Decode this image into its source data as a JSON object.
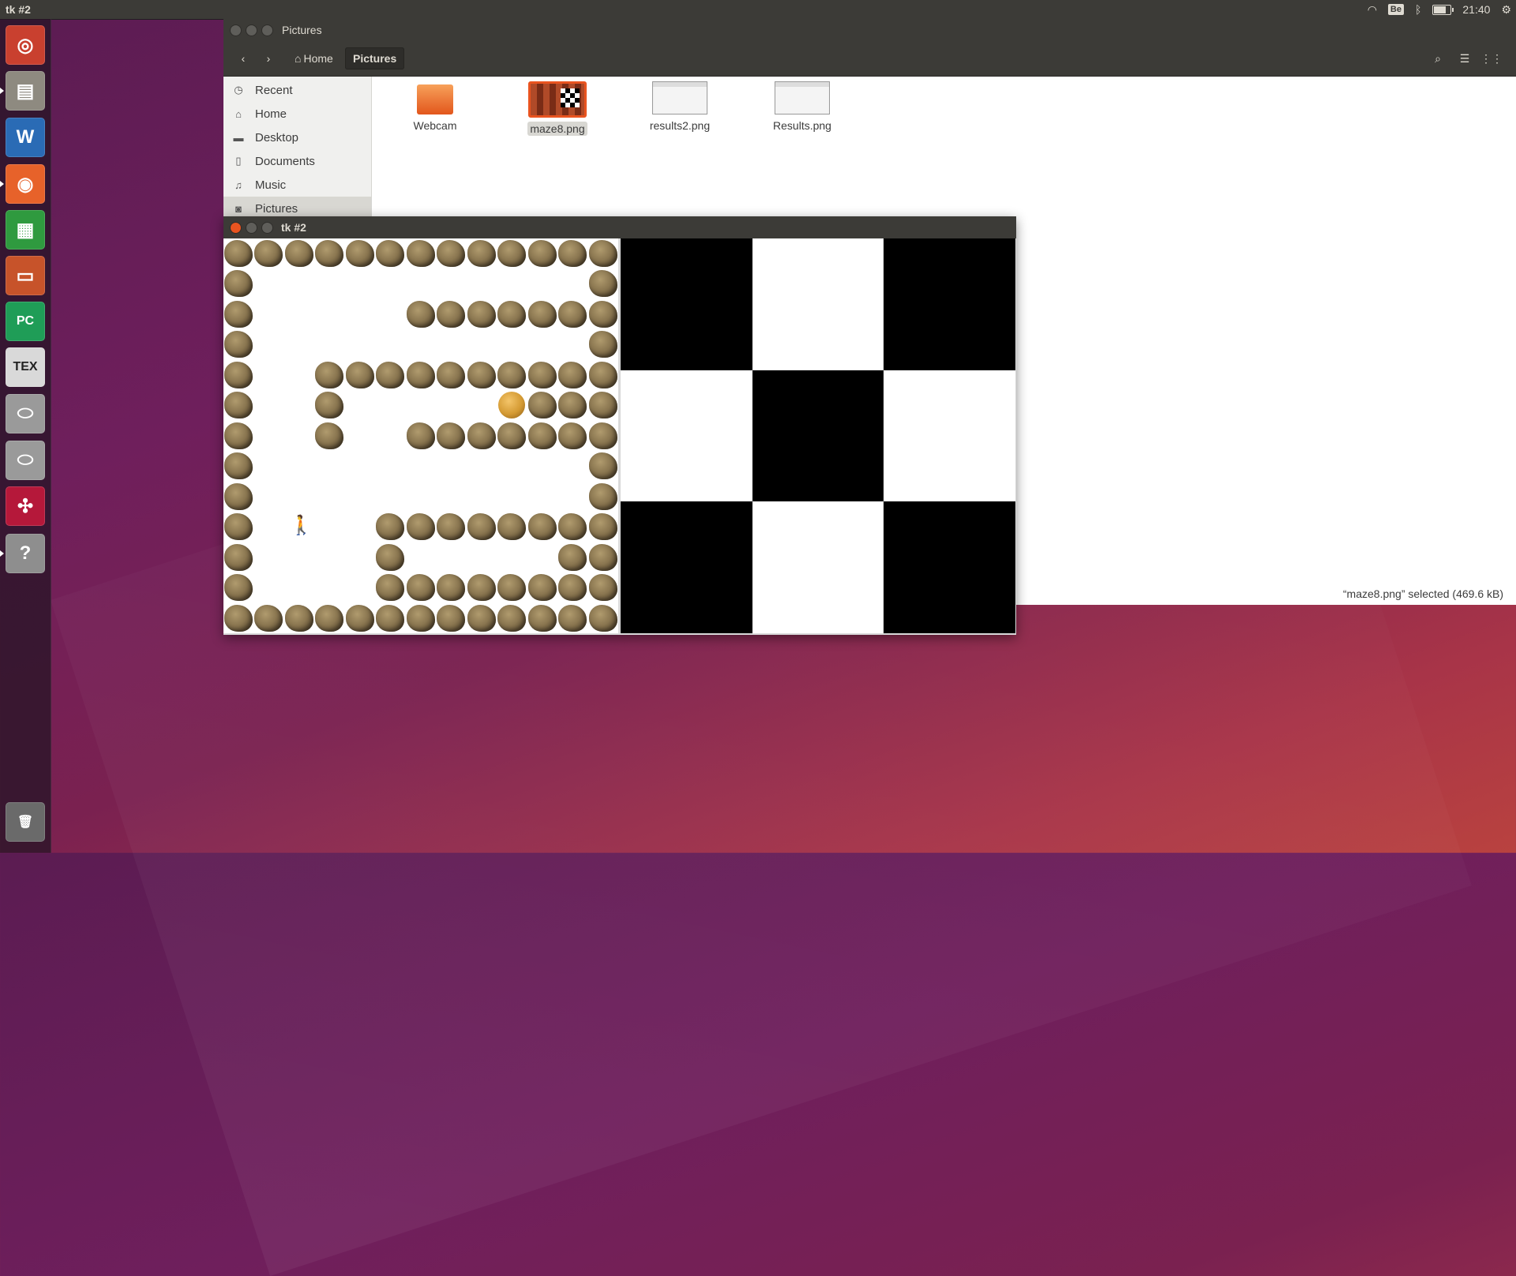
{
  "top_panel": {
    "title": "tk #2",
    "keyboard_layout": "Be",
    "time": "21:40",
    "battery_level": 0.75
  },
  "launcher": {
    "items": [
      {
        "name": "ubuntu-dash",
        "glyph": "◎",
        "color": "#c9402f"
      },
      {
        "name": "files",
        "glyph": "▤",
        "color": "#8e8a80"
      },
      {
        "name": "libreoffice-writer",
        "glyph": "W",
        "color": "#2a6bb5"
      },
      {
        "name": "firefox",
        "glyph": "◉",
        "color": "#e7622a"
      },
      {
        "name": "libreoffice-calc",
        "glyph": "▦",
        "color": "#2f9a3f"
      },
      {
        "name": "libreoffice-impress",
        "glyph": "▭",
        "color": "#c7532a"
      },
      {
        "name": "pycharm",
        "glyph": "PC",
        "color": "#1f9d57"
      },
      {
        "name": "texmaker",
        "glyph": "TEX",
        "color": "#d9d9d9"
      },
      {
        "name": "disk-1",
        "glyph": "⬭",
        "color": "#9a9a9a"
      },
      {
        "name": "disk-2",
        "glyph": "⬭",
        "color": "#9a9a9a"
      },
      {
        "name": "mendeley",
        "glyph": "✣",
        "color": "#b5183a"
      },
      {
        "name": "unknown-app",
        "glyph": "?",
        "color": "#8e8e8e"
      },
      {
        "name": "trash",
        "glyph": "🗑",
        "color": "#6a6a6a"
      }
    ]
  },
  "files_window": {
    "title": "Pictures",
    "breadcrumb": {
      "home": "Home",
      "current": "Pictures"
    },
    "sidebar": [
      {
        "label": "Recent",
        "icon": "clock-icon",
        "glyph": "◷"
      },
      {
        "label": "Home",
        "icon": "home-icon",
        "glyph": "⌂"
      },
      {
        "label": "Desktop",
        "icon": "folder-icon",
        "glyph": "▬"
      },
      {
        "label": "Documents",
        "icon": "document-icon",
        "glyph": "▯"
      },
      {
        "label": "Music",
        "icon": "music-icon",
        "glyph": "♫"
      },
      {
        "label": "Pictures",
        "icon": "camera-icon",
        "glyph": "◙"
      }
    ],
    "files": [
      {
        "label": "Webcam",
        "type": "folder"
      },
      {
        "label": "maze8.png",
        "type": "image-maze"
      },
      {
        "label": "results2.png",
        "type": "image-screenshot"
      },
      {
        "label": "Results.png",
        "type": "image-screenshot"
      }
    ],
    "status": "“maze8.png” selected  (469.6 kB)"
  },
  "tk_window": {
    "title": "tk #2",
    "maze": {
      "rows": [
        "#############",
        "#...........#",
        "#.....#######",
        "#...........#",
        "#..##########",
        "#..#.....C###",
        "#..#..#######",
        "#...........#",
        "#...........#",
        "#.P..########",
        "#....#.....##",
        "#....########",
        "#############"
      ]
    },
    "checker": {
      "cells": [
        "black",
        "white",
        "black",
        "white",
        "black",
        "white",
        "black",
        "white",
        "black"
      ]
    }
  }
}
